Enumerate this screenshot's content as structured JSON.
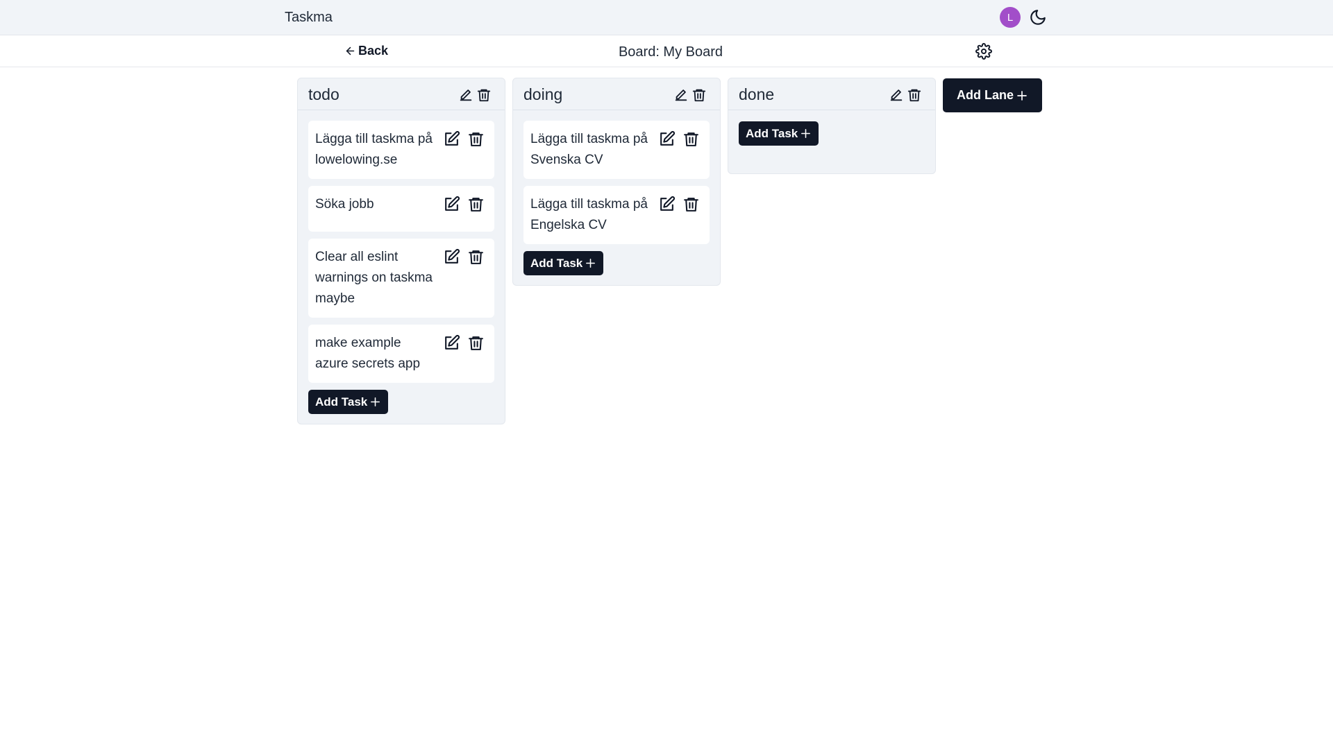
{
  "app": {
    "title": "Taskma"
  },
  "user": {
    "avatar_initial": "L",
    "avatar_color": "#a24ec9"
  },
  "nav": {
    "back_label": "Back",
    "board_title": "Board: My Board"
  },
  "lanes": [
    {
      "title": "todo",
      "tasks": [
        {
          "text": "Lägga till taskma på lowelowing.se"
        },
        {
          "text": "Söka jobb"
        },
        {
          "text": "Clear all eslint warnings on taskma maybe"
        },
        {
          "text": "make example azure secrets app"
        }
      ],
      "add_task_label": "Add Task"
    },
    {
      "title": "doing",
      "tasks": [
        {
          "text": "Lägga till taskma på Svenska CV"
        },
        {
          "text": "Lägga till taskma på Engelska CV"
        }
      ],
      "add_task_label": "Add Task"
    },
    {
      "title": "done",
      "tasks": [],
      "add_task_label": "Add Task"
    }
  ],
  "add_lane_label": "Add Lane",
  "colors": {
    "dark_button": "#111827",
    "lane_bg": "#f0f3f7",
    "topbar_bg": "#f1f4f8"
  }
}
